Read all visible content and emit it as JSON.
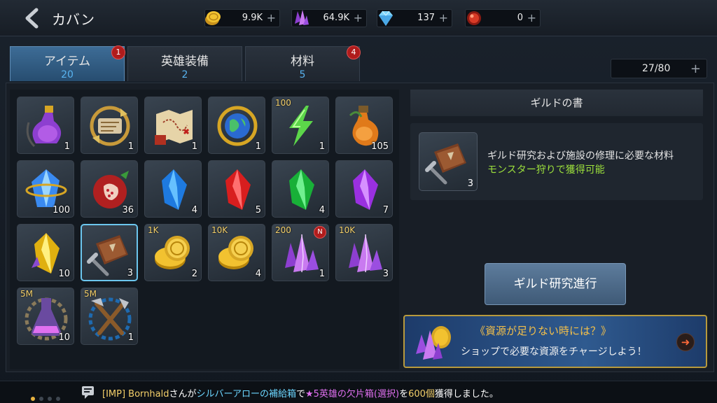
{
  "header": {
    "title": "カバン",
    "resources": [
      {
        "name": "gold",
        "value": "9.9K",
        "color": "#f2c230"
      },
      {
        "name": "crystal",
        "value": "64.9K",
        "color": "#b25ce6"
      },
      {
        "name": "diamond",
        "value": "137",
        "color": "#7fd6ff"
      },
      {
        "name": "ruby",
        "value": "0",
        "color": "#d83a26"
      }
    ],
    "plus_symbol": "+"
  },
  "tabs": [
    {
      "label": "アイテム",
      "count": "20",
      "badge": "1",
      "active": true
    },
    {
      "label": "英雄装備",
      "count": "2",
      "badge": "",
      "active": false
    },
    {
      "label": "材料",
      "count": "5",
      "badge": "4",
      "active": false
    }
  ],
  "capacity": {
    "value": "27/80",
    "plus": "+"
  },
  "items": [
    {
      "icon": "purple-potion-bottle",
      "qty": "1",
      "amt": "",
      "new": ""
    },
    {
      "icon": "exchange-scroll",
      "qty": "1",
      "amt": "",
      "new": ""
    },
    {
      "icon": "treasure-map",
      "qty": "1",
      "amt": "",
      "new": ""
    },
    {
      "icon": "globe-refresh",
      "qty": "1",
      "amt": "",
      "new": ""
    },
    {
      "icon": "lightning-bolt",
      "qty": "1",
      "amt": "100",
      "new": ""
    },
    {
      "icon": "orange-potion",
      "qty": "105",
      "amt": "",
      "new": ""
    },
    {
      "icon": "blue-crystal",
      "qty": "100",
      "amt": "",
      "new": ""
    },
    {
      "icon": "pomegranate",
      "qty": "36",
      "amt": "",
      "new": ""
    },
    {
      "icon": "blue-gem",
      "qty": "4",
      "amt": "",
      "new": ""
    },
    {
      "icon": "red-gem",
      "qty": "5",
      "amt": "",
      "new": ""
    },
    {
      "icon": "green-gem",
      "qty": "4",
      "amt": "",
      "new": ""
    },
    {
      "icon": "purple-gem",
      "qty": "7",
      "amt": "",
      "new": ""
    },
    {
      "icon": "yellow-gem",
      "qty": "10",
      "amt": "",
      "new": ""
    },
    {
      "icon": "guild-book",
      "qty": "3",
      "amt": "",
      "new": "",
      "selected": true
    },
    {
      "icon": "gold-coins",
      "qty": "2",
      "amt": "1K",
      "new": ""
    },
    {
      "icon": "gold-coins",
      "qty": "4",
      "amt": "10K",
      "new": ""
    },
    {
      "icon": "purple-crystals",
      "qty": "1",
      "amt": "200",
      "new": "N"
    },
    {
      "icon": "purple-crystals",
      "qty": "3",
      "amt": "10K",
      "new": ""
    },
    {
      "icon": "flask-gear",
      "qty": "10",
      "amt": "5M",
      "new": ""
    },
    {
      "icon": "tools-gear",
      "qty": "1",
      "amt": "5M",
      "new": ""
    }
  ],
  "detail": {
    "title": "ギルドの書",
    "qty": "3",
    "description": "ギルド研究および施設の修理に必要な材料",
    "source": "モンスター狩りで獲得可能",
    "button": "ギルド研究進行"
  },
  "promo": {
    "title": "《資源が足りない時には？》",
    "text": "ショップで必要な資源をチャージしよう！",
    "arrow": "➜"
  },
  "ticker": {
    "part1": "[IMP] Bornhald",
    "part2": "さんが",
    "part3": "シルバーアローの補給箱",
    "part4": "で",
    "part5": "★5英雄の欠片箱(選択)",
    "part6": "を",
    "part7": "600個",
    "part8": "獲得しました。"
  }
}
